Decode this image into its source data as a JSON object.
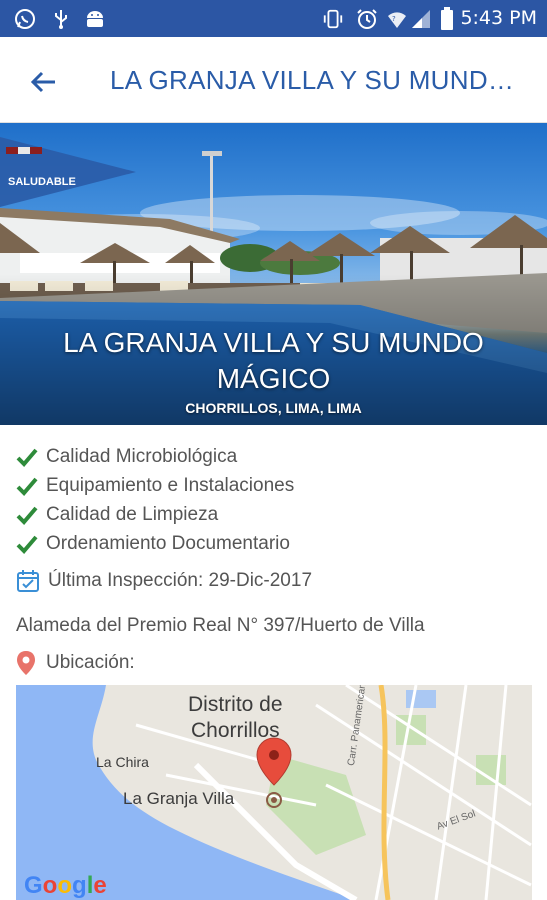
{
  "status_bar": {
    "time": "5:43 PM",
    "icons": [
      "whatsapp-icon",
      "usb-icon",
      "android-icon",
      "vibrate-icon",
      "alarm-icon",
      "wifi-icon",
      "signal-icon",
      "battery-icon"
    ]
  },
  "app_bar": {
    "title": "LA GRANJA VILLA Y SU MUNDO MÁGICO"
  },
  "hero": {
    "badge": "SALUDABLE",
    "title": "LA GRANJA VILLA Y SU MUNDO MÁGICO",
    "subtitle": "CHORRILLOS, LIMA, LIMA"
  },
  "checks": [
    {
      "label": "Calidad Microbiológica"
    },
    {
      "label": "Equipamiento e Instalaciones"
    },
    {
      "label": "Calidad de Limpieza"
    },
    {
      "label": "Ordenamiento Documentario"
    }
  ],
  "inspection": {
    "label": "Última Inspección: 29-Dic-2017"
  },
  "address": "Alameda del Premio Real N° 397/Huerto de Villa",
  "location_label": "Ubicación:",
  "map": {
    "district_line1": "Distrito de",
    "district_line2": "Chorrillos",
    "place_la_chira": "La Chira",
    "place_marker": "La Granja Villa",
    "road_panamericana": "Carr. Panamericana Sur",
    "road_av_el_sol": "Av El Sol",
    "google": "Google"
  },
  "colors": {
    "status_bar": "#2c56a4",
    "accent": "#2a5ca8",
    "check": "#2e8b3a",
    "pin": "#e2574c"
  }
}
